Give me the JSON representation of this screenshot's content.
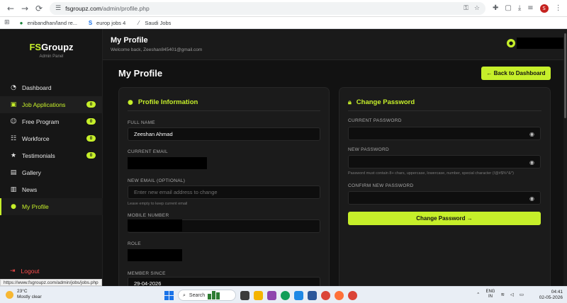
{
  "browser": {
    "url_host": "fsgroupz.com",
    "url_path": "/admin/profile.php",
    "bookmarks": [
      {
        "label": "enibandhan/land re..."
      },
      {
        "label": "europ jobs 4"
      },
      {
        "label": "Saudi Jobs"
      }
    ],
    "status_url": "https://www.fsgroupz.com/admin/jobs/jobs.php",
    "profile_initial": "S"
  },
  "sidebar": {
    "brand_fs": "FS",
    "brand_rest": "Groupz",
    "subtitle": "Admin Panel",
    "items": [
      {
        "label": "Dashboard",
        "icon": "gauge-icon",
        "badge": null
      },
      {
        "label": "Job Applications",
        "icon": "briefcase-icon",
        "badge": "0"
      },
      {
        "label": "Free Program",
        "icon": "users-icon",
        "badge": "0"
      },
      {
        "label": "Workforce",
        "icon": "workforce-icon",
        "badge": "0"
      },
      {
        "label": "Testimonials",
        "icon": "star-icon",
        "badge": "0"
      },
      {
        "label": "Gallery",
        "icon": "image-icon",
        "badge": null
      },
      {
        "label": "News",
        "icon": "newspaper-icon",
        "badge": null
      },
      {
        "label": "My Profile",
        "icon": "user-icon",
        "badge": null
      }
    ],
    "logout": "Logout"
  },
  "topbar": {
    "title": "My Profile",
    "welcome": "Welcome back, Zeeshan845401@gmail.com"
  },
  "main": {
    "page_title": "My Profile",
    "back_button": "← Back to Dashboard",
    "profile": {
      "heading": "Profile Information",
      "full_name_label": "FULL NAME",
      "full_name_value": "Zeeshan Ahmad",
      "current_email_label": "CURRENT EMAIL",
      "new_email_label": "NEW EMAIL (OPTIONAL)",
      "new_email_placeholder": "Enter new email address to change",
      "new_email_hint": "Leave empty to keep current email",
      "mobile_label": "MOBILE NUMBER",
      "role_label": "ROLE",
      "member_since_label": "MEMBER SINCE",
      "member_since_value": "29-04-2026"
    },
    "password": {
      "heading": "Change Password",
      "current_label": "CURRENT PASSWORD",
      "new_label": "NEW PASSWORD",
      "new_hint": "Password must contain 8+ chars, uppercase, lowercase, number, special character (!@#$%^&*)",
      "confirm_label": "CONFIRM NEW PASSWORD",
      "submit": "Change Password →"
    }
  },
  "taskbar": {
    "temp": "23°C",
    "weather": "Mostly clear",
    "search": "Search",
    "lang1": "ENG",
    "lang2": "IN",
    "time": "04:41",
    "date": "02-05-2026"
  },
  "colors": {
    "accent": "#c6ef2a",
    "logout": "#ff4d4d",
    "background": "#121212"
  }
}
